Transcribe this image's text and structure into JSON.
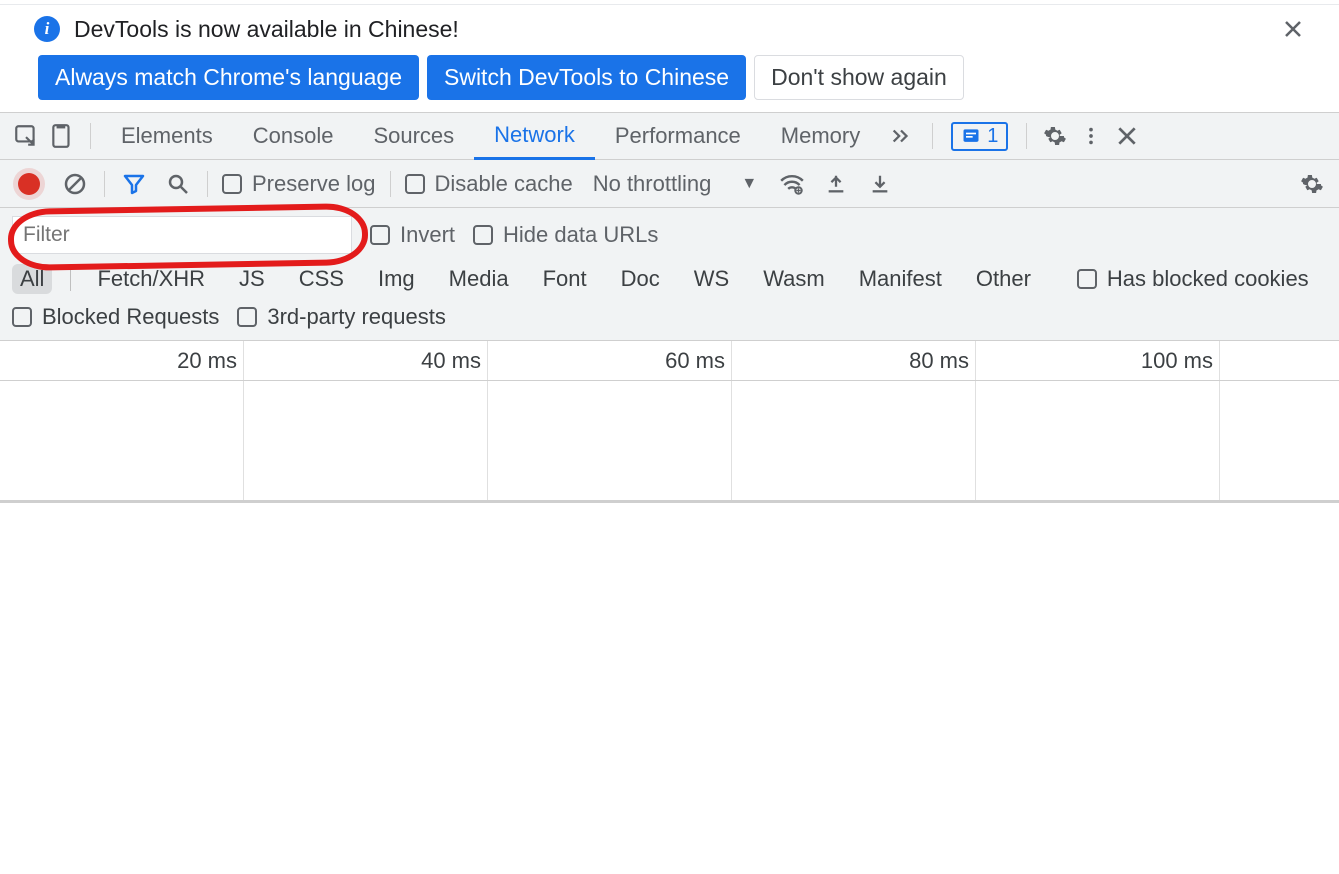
{
  "banner": {
    "message": "DevTools is now available in Chinese!",
    "btn_match": "Always match Chrome's language",
    "btn_switch": "Switch DevTools to Chinese",
    "btn_dont": "Don't show again"
  },
  "tabs": {
    "elements": "Elements",
    "console": "Console",
    "sources": "Sources",
    "network": "Network",
    "performance": "Performance",
    "memory": "Memory",
    "badge_count": "1"
  },
  "toolbar": {
    "preserve_log": "Preserve log",
    "disable_cache": "Disable cache",
    "throttling": "No throttling"
  },
  "filter": {
    "placeholder": "Filter",
    "invert": "Invert",
    "hide_data_urls": "Hide data URLs",
    "types": [
      "All",
      "Fetch/XHR",
      "JS",
      "CSS",
      "Img",
      "Media",
      "Font",
      "Doc",
      "WS",
      "Wasm",
      "Manifest",
      "Other"
    ],
    "has_blocked_cookies": "Has blocked cookies",
    "blocked_requests": "Blocked Requests",
    "third_party": "3rd-party requests"
  },
  "timeline": {
    "ticks": [
      "20 ms",
      "40 ms",
      "60 ms",
      "80 ms",
      "100 ms"
    ]
  }
}
